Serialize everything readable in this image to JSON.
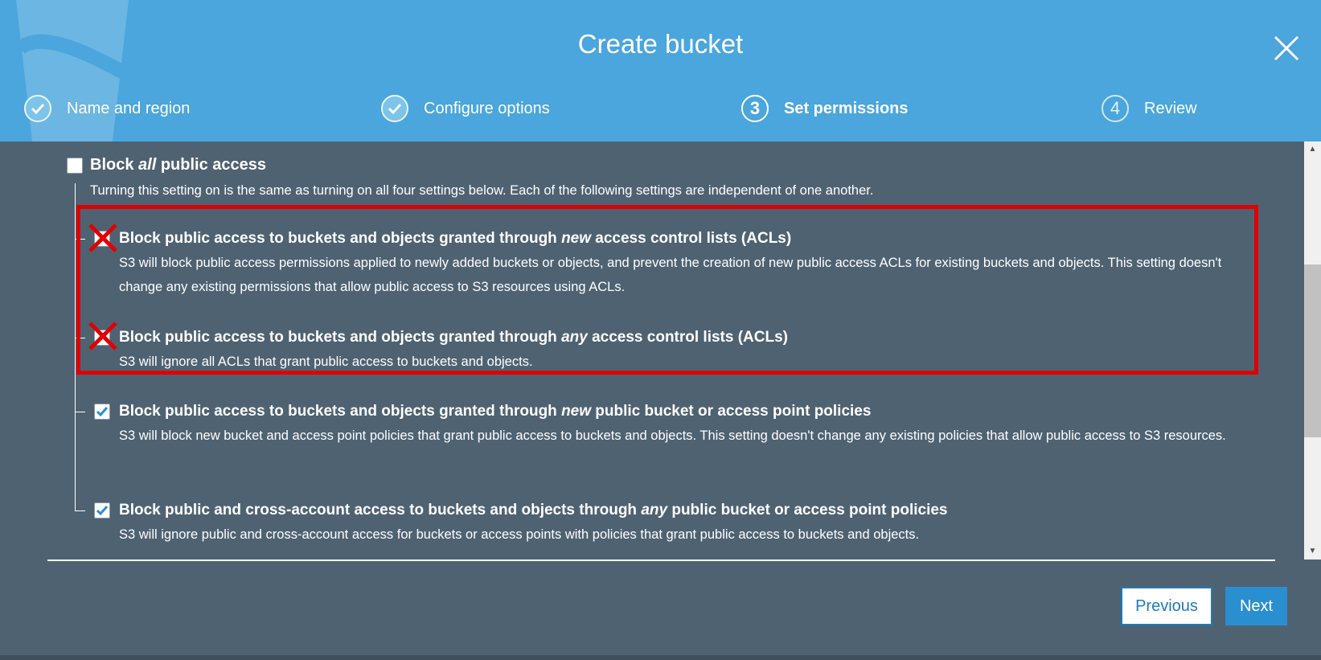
{
  "modal": {
    "title": "Create bucket",
    "close_icon": "close-icon"
  },
  "steps": [
    {
      "label": "Name and region",
      "state": "done",
      "icon": "checkmark-icon"
    },
    {
      "label": "Configure options",
      "state": "done",
      "icon": "checkmark-icon"
    },
    {
      "number": "3",
      "label": "Set permissions",
      "state": "active"
    },
    {
      "number": "4",
      "label": "Review",
      "state": "upcoming"
    }
  ],
  "block_all": {
    "label_prefix": "Block ",
    "label_emphasis": "all",
    "label_suffix": " public access",
    "checked": false,
    "description": "Turning this setting on is the same as turning on all four settings below. Each of the following settings are independent of one another."
  },
  "settings": [
    {
      "title_prefix": "Block public access to buckets and objects granted through ",
      "title_emphasis": "new",
      "title_suffix": " access control lists (ACLs)",
      "description": "S3 will block public access permissions applied to newly added buckets or objects, and prevent the creation of new public access ACLs for existing buckets and objects. This setting doesn't change any existing permissions that allow public access to S3 resources using ACLs.",
      "checked": false,
      "marked": "x-mark"
    },
    {
      "title_prefix": "Block public access to buckets and objects granted through ",
      "title_emphasis": "any",
      "title_suffix": " access control lists (ACLs)",
      "description": "S3 will ignore all ACLs that grant public access to buckets and objects.",
      "checked": false,
      "marked": "x-mark"
    },
    {
      "title_prefix": "Block public access to buckets and objects granted through ",
      "title_emphasis": "new",
      "title_suffix": " public bucket or access point policies",
      "description": "S3 will block new bucket and access point policies that grant public access to buckets and objects. This setting doesn't change any existing policies that allow public access to S3 resources.",
      "checked": true
    },
    {
      "title_prefix": "Block public and cross-account access to buckets and objects through ",
      "title_emphasis": "any",
      "title_suffix": " public bucket or access point policies",
      "description": "S3 will ignore public and cross-account access for buckets or access points with policies that grant public access to buckets and objects.",
      "checked": true
    }
  ],
  "footer": {
    "previous_label": "Previous",
    "next_label": "Next"
  },
  "colors": {
    "header_bg": "#4aa6dc",
    "body_bg": "#4f6272",
    "highlight_box": "#e00000",
    "checkbox_check": "#2a8fd1",
    "primary_button": "#2a8fd1"
  }
}
